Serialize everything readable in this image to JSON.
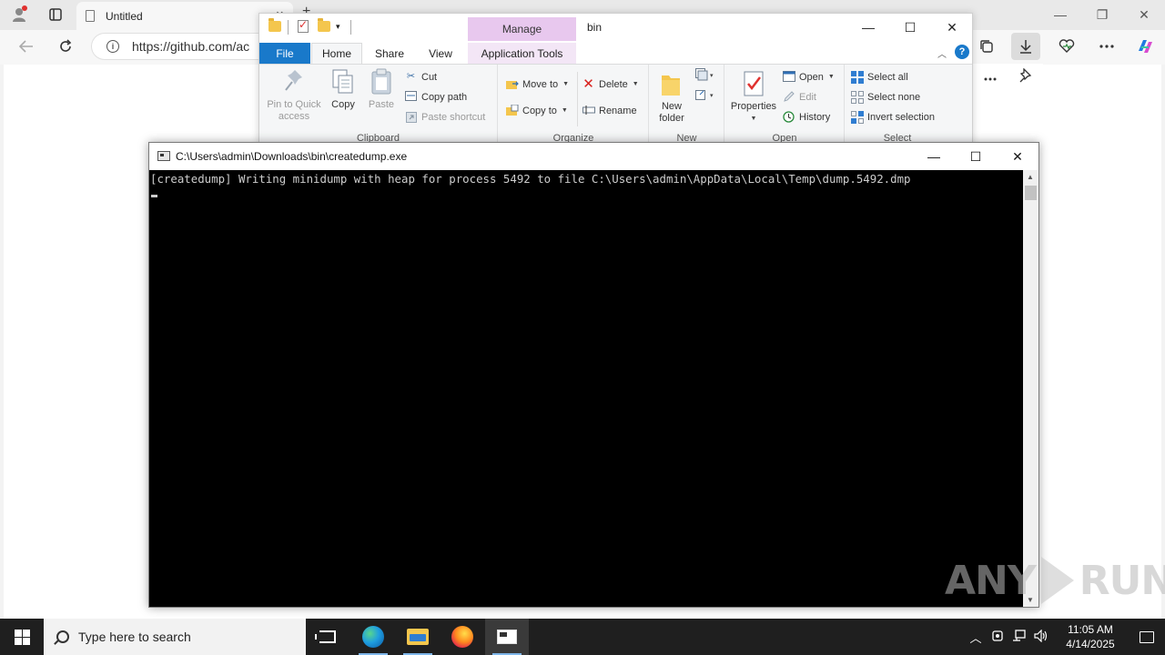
{
  "edge": {
    "tab_title": "Untitled",
    "tab_close": "✕",
    "new_tab": "+",
    "url": "https://github.com/ac",
    "minimize": "—",
    "restore": "❐",
    "close": "✕"
  },
  "explorer": {
    "title": "bin",
    "manage_label": "Manage",
    "tabs": {
      "file": "File",
      "home": "Home",
      "share": "Share",
      "view": "View",
      "app_tools": "Application Tools"
    },
    "clipboard": {
      "label": "Clipboard",
      "pin": "Pin to Quick access",
      "copy": "Copy",
      "paste": "Paste",
      "cut": "Cut",
      "copy_path": "Copy path",
      "paste_shortcut": "Paste shortcut"
    },
    "organize": {
      "label": "Organize",
      "move_to": "Move to",
      "copy_to": "Copy to",
      "delete": "Delete",
      "rename": "Rename"
    },
    "new": {
      "label": "New",
      "new_folder": "New folder"
    },
    "open": {
      "label": "Open",
      "properties": "Properties",
      "open": "Open",
      "edit": "Edit",
      "history": "History"
    },
    "select": {
      "label": "Select",
      "select_all": "Select all",
      "select_none": "Select none",
      "invert": "Invert selection"
    },
    "minimize": "—",
    "maximize": "☐",
    "close": "✕",
    "help": "?"
  },
  "console": {
    "title": "C:\\Users\\admin\\Downloads\\bin\\createdump.exe",
    "output": "[createdump] Writing minidump with heap for process 5492 to file C:\\Users\\admin\\AppData\\Local\\Temp\\dump.5492.dmp",
    "minimize": "—",
    "maximize": "☐",
    "close": "✕"
  },
  "watermark": {
    "left": "ANY",
    "right": "RUN"
  },
  "taskbar": {
    "search_placeholder": "Type here to search",
    "time": "11:05 AM",
    "date": "4/14/2025"
  },
  "colors": {
    "file_tab": "#1979ca",
    "manage_tab": "#e8c8ee",
    "console_bg": "#000000",
    "taskbar_bg": "#1f1f1f"
  }
}
